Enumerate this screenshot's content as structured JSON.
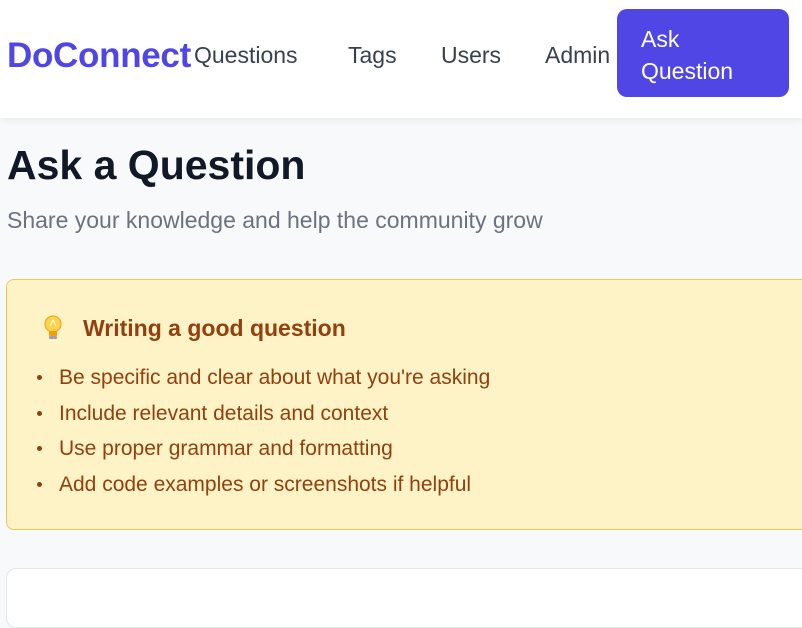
{
  "header": {
    "logo": "DoConnect",
    "nav": [
      "Questions",
      "Tags",
      "Users",
      "Admin"
    ],
    "ask_button": "Ask Question"
  },
  "page": {
    "title": "Ask a Question",
    "subtitle": "Share your knowledge and help the community grow"
  },
  "tips": {
    "icon": "lightbulb-icon",
    "title": "Writing a good question",
    "items": [
      "Be specific and clear about what you're asking",
      "Include relevant details and context",
      "Use proper grammar and formatting",
      "Add code examples or screenshots if helpful"
    ]
  },
  "colors": {
    "brand": "#4f46e5",
    "tips_bg": "#fef3c7",
    "tips_border": "#f6c84a",
    "tips_text": "#92400e"
  }
}
